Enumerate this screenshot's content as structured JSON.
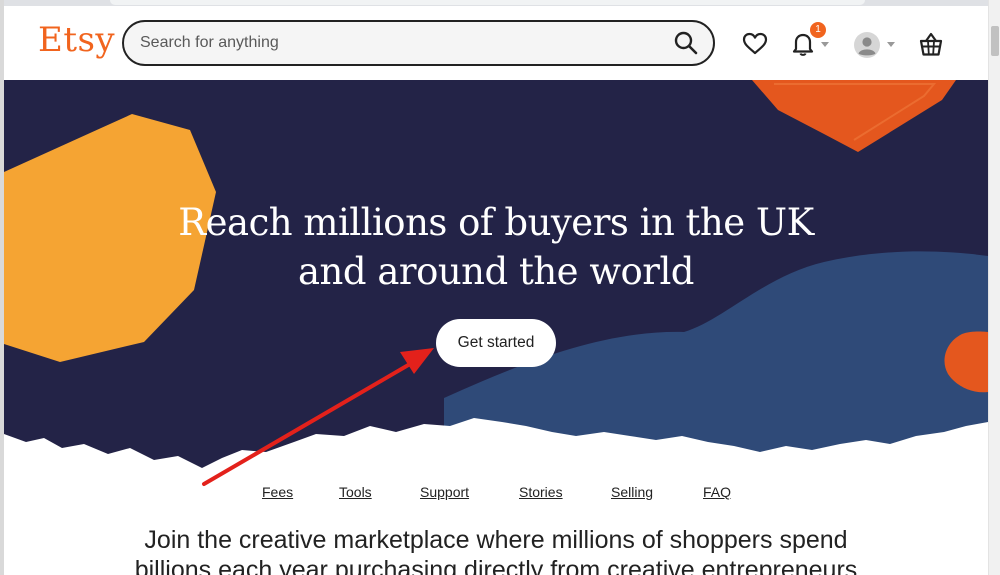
{
  "header": {
    "logo": "Etsy",
    "search_placeholder": "Search for anything",
    "notification_count": "1"
  },
  "hero": {
    "title_line1": "Reach millions of buyers in the UK",
    "title_line2": "and around the world",
    "cta_label": "Get started"
  },
  "sub_nav": {
    "items": [
      "Fees",
      "Tools",
      "Support",
      "Stories",
      "Selling",
      "FAQ"
    ]
  },
  "headline": {
    "line1": "Join the creative marketplace where millions of shoppers spend",
    "line2": "billions each year purchasing directly from creative entrepreneurs"
  },
  "colors": {
    "brand_orange": "#f1641e",
    "hero_navy": "#232347",
    "hero_blue": "#2f4a78",
    "shape_yellow": "#f5a433",
    "shape_orange": "#e4571e",
    "annotation_arrow": "#e3211b"
  },
  "icons": {
    "search": "search-icon",
    "favorites": "heart-icon",
    "notifications": "bell-icon",
    "account": "avatar-icon",
    "cart": "basket-icon"
  }
}
